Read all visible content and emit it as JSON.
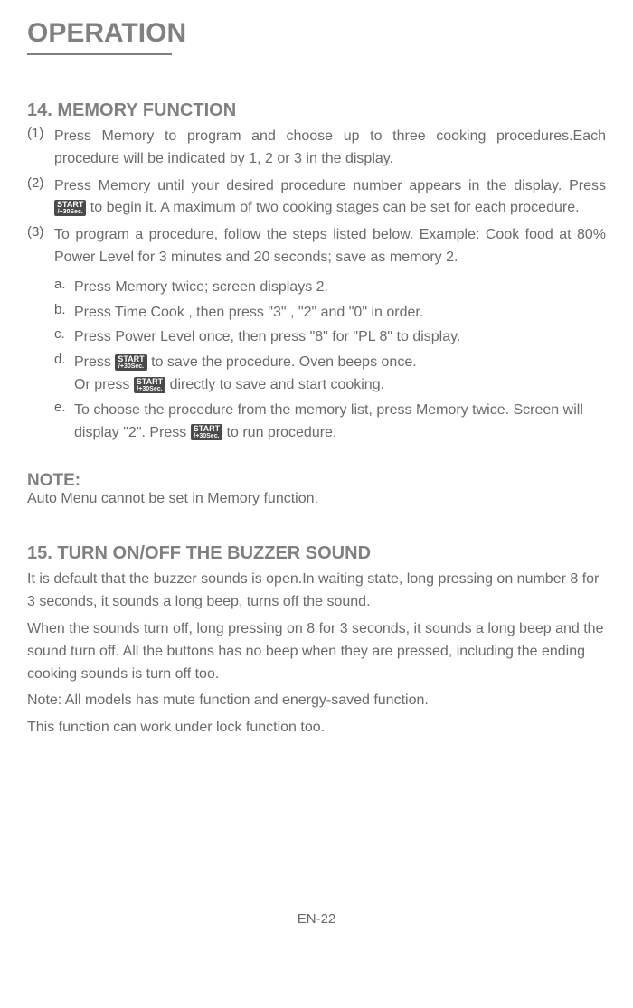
{
  "title": "OPERATION",
  "section14": {
    "heading": "14. MEMORY FUNCTION",
    "items": [
      {
        "num": "(1)",
        "text": "Press Memory to program and choose up to three cooking procedures.Each procedure will be indicated by 1, 2 or 3 in the display."
      },
      {
        "num": "(2)",
        "text_before": "Press  Memory until your desired procedure number appears in the display. Press ",
        "text_after": " to begin it. A maximum of two cooking stages can be set for each procedure."
      },
      {
        "num": "(3)",
        "text": "To program a procedure, follow the steps listed below. Example: Cook food at 80%  Power Level for 3 minutes and 20 seconds; save as memory 2."
      }
    ],
    "subitems": [
      {
        "label": "a.",
        "text": "Press Memory twice; screen displays 2."
      },
      {
        "label": "b.",
        "text": "Press Time Cook , then press \"3\" , \"2\" and \"0\" in order."
      },
      {
        "label": "c.",
        "text": "Press Power  Level once, then press \"8\" for \"PL 8\" to display."
      },
      {
        "label": "d.",
        "text_before": "Press ",
        "text_mid": "  to save the procedure. Oven beeps once.",
        "text_or_before": "Or press ",
        "text_or_after": " directly to save and start cooking."
      },
      {
        "label": "e.",
        "text_before": "To choose the procedure from the memory list, press  Memory  twice. Screen will display \"2\".  Press   ",
        "text_after": "   to run procedure."
      }
    ]
  },
  "start_button": {
    "top": "START",
    "bottom": "/+30Sec."
  },
  "note": {
    "heading": "NOTE:",
    "text": "Auto Menu cannot be set in Memory function."
  },
  "section15": {
    "heading": "15. TURN ON/OFF THE BUZZER SOUND",
    "p1": "It is default that the buzzer sounds is open.In waiting state, long pressing on number  8 for 3 seconds, it sounds a long beep, turns off the sound.",
    "p2": "When the sounds turn off, long pressing on 8 for 3 seconds, it sounds a long beep and the sound turn off. All the buttons has no beep when they are pressed, including the ending cooking sounds is turn off too.",
    "p3": "Note: All models has mute function and energy-saved function.",
    "p4": "This function can work under lock function too."
  },
  "page_number": "EN-22"
}
